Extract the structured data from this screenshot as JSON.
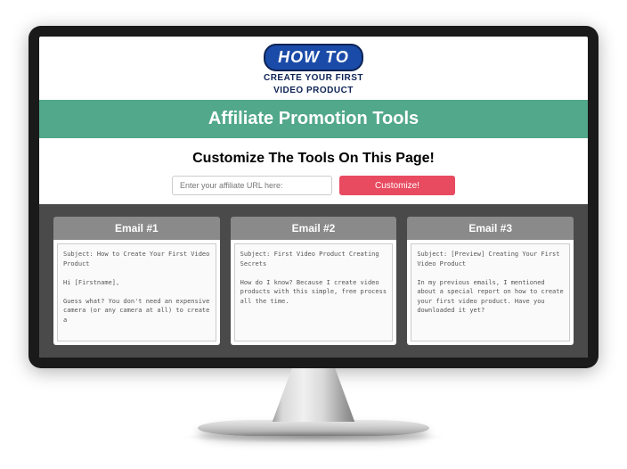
{
  "logo": {
    "top": "HOW TO",
    "line1": "CREATE YOUR FIRST",
    "line2": "VIDEO PRODUCT"
  },
  "banner": "Affiliate Promotion Tools",
  "customize": {
    "title": "Customize The Tools On This Page!",
    "placeholder": "Enter your affiliate URL here:",
    "button": "Customize!"
  },
  "emails": [
    {
      "title": "Email #1",
      "content": "Subject: How to Create Your First Video Product\n\nHi [Firstname],\n\nGuess what? You don't need an expensive camera (or any camera at all) to create a"
    },
    {
      "title": "Email #2",
      "content": "Subject: First Video Product Creating Secrets\n\nHow do I know? Because I create video products with this simple, free process all the time."
    },
    {
      "title": "Email #3",
      "content": "Subject: [Preview] Creating Your First Video Product\n\nIn my previous emails, I mentioned about a special report on how to create your first video product. Have you downloaded it yet?"
    }
  ]
}
